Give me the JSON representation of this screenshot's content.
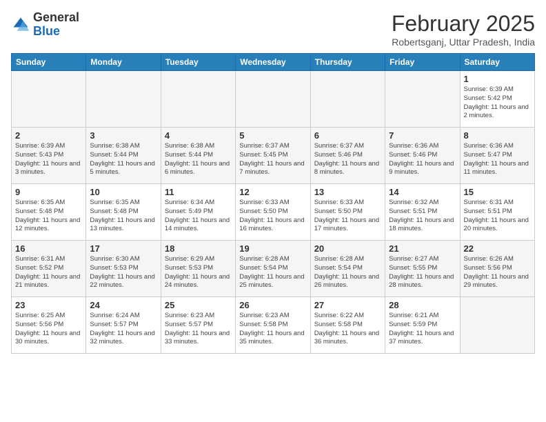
{
  "header": {
    "logo_general": "General",
    "logo_blue": "Blue",
    "month_year": "February 2025",
    "location": "Robertsganj, Uttar Pradesh, India"
  },
  "weekdays": [
    "Sunday",
    "Monday",
    "Tuesday",
    "Wednesday",
    "Thursday",
    "Friday",
    "Saturday"
  ],
  "weeks": [
    [
      {
        "day": "",
        "info": ""
      },
      {
        "day": "",
        "info": ""
      },
      {
        "day": "",
        "info": ""
      },
      {
        "day": "",
        "info": ""
      },
      {
        "day": "",
        "info": ""
      },
      {
        "day": "",
        "info": ""
      },
      {
        "day": "1",
        "info": "Sunrise: 6:39 AM\nSunset: 5:42 PM\nDaylight: 11 hours and 2 minutes."
      }
    ],
    [
      {
        "day": "2",
        "info": "Sunrise: 6:39 AM\nSunset: 5:43 PM\nDaylight: 11 hours and 3 minutes."
      },
      {
        "day": "3",
        "info": "Sunrise: 6:38 AM\nSunset: 5:44 PM\nDaylight: 11 hours and 5 minutes."
      },
      {
        "day": "4",
        "info": "Sunrise: 6:38 AM\nSunset: 5:44 PM\nDaylight: 11 hours and 6 minutes."
      },
      {
        "day": "5",
        "info": "Sunrise: 6:37 AM\nSunset: 5:45 PM\nDaylight: 11 hours and 7 minutes."
      },
      {
        "day": "6",
        "info": "Sunrise: 6:37 AM\nSunset: 5:46 PM\nDaylight: 11 hours and 8 minutes."
      },
      {
        "day": "7",
        "info": "Sunrise: 6:36 AM\nSunset: 5:46 PM\nDaylight: 11 hours and 9 minutes."
      },
      {
        "day": "8",
        "info": "Sunrise: 6:36 AM\nSunset: 5:47 PM\nDaylight: 11 hours and 11 minutes."
      }
    ],
    [
      {
        "day": "9",
        "info": "Sunrise: 6:35 AM\nSunset: 5:48 PM\nDaylight: 11 hours and 12 minutes."
      },
      {
        "day": "10",
        "info": "Sunrise: 6:35 AM\nSunset: 5:48 PM\nDaylight: 11 hours and 13 minutes."
      },
      {
        "day": "11",
        "info": "Sunrise: 6:34 AM\nSunset: 5:49 PM\nDaylight: 11 hours and 14 minutes."
      },
      {
        "day": "12",
        "info": "Sunrise: 6:33 AM\nSunset: 5:50 PM\nDaylight: 11 hours and 16 minutes."
      },
      {
        "day": "13",
        "info": "Sunrise: 6:33 AM\nSunset: 5:50 PM\nDaylight: 11 hours and 17 minutes."
      },
      {
        "day": "14",
        "info": "Sunrise: 6:32 AM\nSunset: 5:51 PM\nDaylight: 11 hours and 18 minutes."
      },
      {
        "day": "15",
        "info": "Sunrise: 6:31 AM\nSunset: 5:51 PM\nDaylight: 11 hours and 20 minutes."
      }
    ],
    [
      {
        "day": "16",
        "info": "Sunrise: 6:31 AM\nSunset: 5:52 PM\nDaylight: 11 hours and 21 minutes."
      },
      {
        "day": "17",
        "info": "Sunrise: 6:30 AM\nSunset: 5:53 PM\nDaylight: 11 hours and 22 minutes."
      },
      {
        "day": "18",
        "info": "Sunrise: 6:29 AM\nSunset: 5:53 PM\nDaylight: 11 hours and 24 minutes."
      },
      {
        "day": "19",
        "info": "Sunrise: 6:28 AM\nSunset: 5:54 PM\nDaylight: 11 hours and 25 minutes."
      },
      {
        "day": "20",
        "info": "Sunrise: 6:28 AM\nSunset: 5:54 PM\nDaylight: 11 hours and 26 minutes."
      },
      {
        "day": "21",
        "info": "Sunrise: 6:27 AM\nSunset: 5:55 PM\nDaylight: 11 hours and 28 minutes."
      },
      {
        "day": "22",
        "info": "Sunrise: 6:26 AM\nSunset: 5:56 PM\nDaylight: 11 hours and 29 minutes."
      }
    ],
    [
      {
        "day": "23",
        "info": "Sunrise: 6:25 AM\nSunset: 5:56 PM\nDaylight: 11 hours and 30 minutes."
      },
      {
        "day": "24",
        "info": "Sunrise: 6:24 AM\nSunset: 5:57 PM\nDaylight: 11 hours and 32 minutes."
      },
      {
        "day": "25",
        "info": "Sunrise: 6:23 AM\nSunset: 5:57 PM\nDaylight: 11 hours and 33 minutes."
      },
      {
        "day": "26",
        "info": "Sunrise: 6:23 AM\nSunset: 5:58 PM\nDaylight: 11 hours and 35 minutes."
      },
      {
        "day": "27",
        "info": "Sunrise: 6:22 AM\nSunset: 5:58 PM\nDaylight: 11 hours and 36 minutes."
      },
      {
        "day": "28",
        "info": "Sunrise: 6:21 AM\nSunset: 5:59 PM\nDaylight: 11 hours and 37 minutes."
      },
      {
        "day": "",
        "info": ""
      }
    ]
  ]
}
